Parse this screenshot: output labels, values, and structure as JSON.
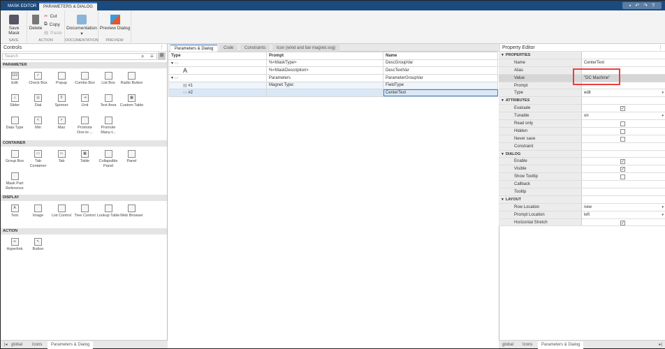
{
  "topbar": {
    "tabs": [
      "MASK EDITOR",
      "PARAMETERS & DIALOG"
    ]
  },
  "toolbar": {
    "save_mask": "Save Mask",
    "save_group": "SAVE",
    "delete": "Delete",
    "cut": "Cut",
    "copy": "Copy",
    "paste": "Paste",
    "action_group": "ACTION",
    "documentation": "Documentation",
    "documentation_group": "DOCUMENTATION",
    "preview_dialog": "Preview Dialog",
    "preview_group": "PREVIEW"
  },
  "controls": {
    "title": "Controls",
    "search_placeholder": "Search",
    "sections": [
      {
        "title": "PARAMETER",
        "items": [
          "Edit",
          "Check Box",
          "Popup",
          "Combo Box",
          "List Box",
          "Radio Button",
          "Slider",
          "Dial",
          "Spinner",
          "Unit",
          "Text Area",
          "Custom Table",
          "Data Type",
          "Min",
          "Max",
          "Promote One-to ...",
          "Promote Many-t..."
        ]
      },
      {
        "title": "CONTAINER",
        "items": [
          "Group Box",
          "Tab Container",
          "Tab",
          "Table",
          "Collapsible Panel",
          "Panel",
          "Mask Part Reference"
        ]
      },
      {
        "title": "DISPLAY",
        "items": [
          "Text",
          "Image",
          "List Control",
          "Tree Control",
          "Lookup Table",
          "Web Browser"
        ]
      },
      {
        "title": "ACTION",
        "items": [
          "Hyperlink",
          "Button"
        ]
      }
    ]
  },
  "center": {
    "tabs": [
      "Parameters & Dialog",
      "Code",
      "Constraints",
      "Icon (wind and bar magnet.svg)"
    ],
    "columns": [
      "Type",
      "Prompt",
      "Name"
    ],
    "rows": [
      {
        "type": "",
        "prompt": "%<MaskType>",
        "name": "DescGroupVar"
      },
      {
        "type": "A",
        "prompt": "%<MaskDescription>",
        "name": "DescTextVar"
      },
      {
        "type": "",
        "prompt": "Parameters",
        "name": "ParameterGroupVar"
      },
      {
        "type": "#1",
        "prompt": "Magnet Type:",
        "name": "FieldType"
      },
      {
        "type": "#2",
        "prompt": "",
        "name": "CenterText"
      }
    ]
  },
  "property_editor": {
    "title": "Property Editor",
    "rows": [
      {
        "h": "PROPERTIES"
      },
      {
        "l": "Name",
        "v": "CenterText"
      },
      {
        "l": "Alias",
        "v": ""
      },
      {
        "l": "Value",
        "v": "\"DC Machine\""
      },
      {
        "l": "Prompt",
        "v": ""
      },
      {
        "l": "Type",
        "v": "edit",
        "dd": true
      },
      {
        "h": "ATTRIBUTES"
      },
      {
        "l": "Evaluate",
        "cb": true
      },
      {
        "l": "Tunable",
        "v": "on",
        "dd": true
      },
      {
        "l": "Read only",
        "cb": false
      },
      {
        "l": "Hidden",
        "cb": false
      },
      {
        "l": "Never save",
        "cb": false
      },
      {
        "l": "Constraint",
        "v": ""
      },
      {
        "h": "DIALOG"
      },
      {
        "l": "Enable",
        "cb": true
      },
      {
        "l": "Visible",
        "cb": true
      },
      {
        "l": "Show Tooltip",
        "cb": false
      },
      {
        "l": "Callback",
        "v": ""
      },
      {
        "l": "Tooltip",
        "v": ""
      },
      {
        "h": "LAYOUT"
      },
      {
        "l": "Row Location",
        "v": "new",
        "dd": true
      },
      {
        "l": "Prompt Location",
        "v": "left",
        "dd": true
      },
      {
        "l": "Horizontal Stretch",
        "cb": true
      }
    ]
  },
  "bottom_tabs_left": [
    "global",
    "Icons",
    "Parameters & Dialog"
  ],
  "bottom_tabs_right": [
    "global",
    "Icons",
    "Parameters & Dialog"
  ],
  "colors": {
    "accent": "#3d7ed1",
    "topbar": "#1b4a7e",
    "highlight_box": "#e8403f"
  }
}
